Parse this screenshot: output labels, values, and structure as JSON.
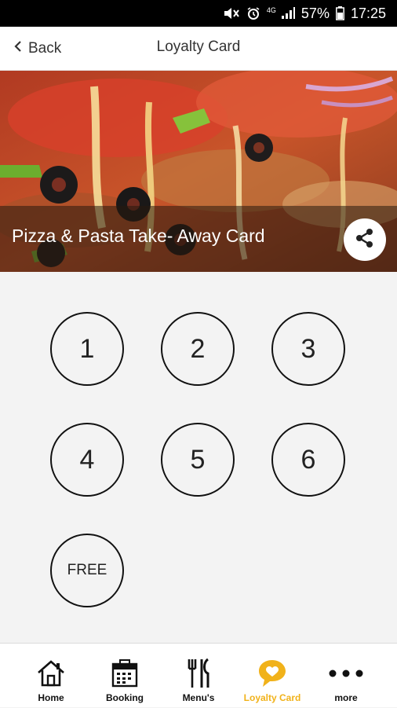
{
  "status_bar": {
    "network": "4G",
    "battery_percent": "57%",
    "time": "17:25"
  },
  "header": {
    "back_label": "Back",
    "title": "Loyalty Card"
  },
  "banner": {
    "title": "Pizza & Pasta Take- Away Card"
  },
  "stamps": [
    "1",
    "2",
    "3",
    "4",
    "5",
    "6",
    "FREE"
  ],
  "bottom_nav": {
    "items": [
      {
        "label": "Home",
        "icon": "home-icon"
      },
      {
        "label": "Booking",
        "icon": "calendar-icon"
      },
      {
        "label": "Menu's",
        "icon": "cutlery-icon"
      },
      {
        "label": "Loyalty Card",
        "icon": "heart-bubble-icon",
        "active": true
      },
      {
        "label": "more",
        "icon": "more-dots-icon"
      }
    ]
  },
  "colors": {
    "accent": "#f1b21a",
    "background": "#f3f3f3",
    "status_bar": "#000000"
  }
}
